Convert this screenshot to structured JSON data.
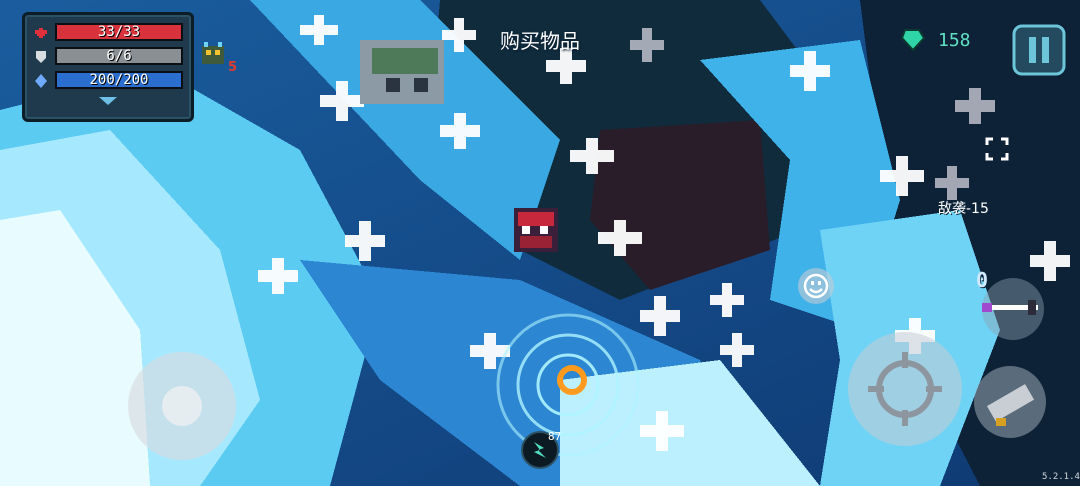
{
  "hud": {
    "hp": {
      "label": "33/33",
      "current": 33,
      "max": 33,
      "color": "#d8323c"
    },
    "armor": {
      "label": "6/6",
      "current": 6,
      "max": 6,
      "color": "#8a8f94"
    },
    "energy": {
      "label": "200/200",
      "current": 200,
      "max": 200,
      "color": "#2a6fd0"
    },
    "buff_count": "5",
    "gem_count": "158",
    "enemy_wave_label": "敌袭-15",
    "weapon_energy": "0",
    "skill_count": "87",
    "version": "5.2.1.4"
  },
  "dialog_title": "购买物品",
  "icons": {
    "heart": "heart-icon",
    "shield": "shield-icon",
    "energy": "energy-crystal-icon",
    "gem": "gem-icon",
    "pause": "pause-icon",
    "emote": "emote-icon",
    "fire": "fire-button-icon",
    "weapon_swap": "weapon-swap-icon",
    "skill": "skill-icon",
    "collapse": "chevron-down-icon"
  },
  "colors": {
    "ice_light": "#bff0ff",
    "ice_mid": "#52c6f0",
    "ice_deep": "#1d6fc0",
    "hud_panel": "#1f3a4c",
    "gem": "#2fd5a6"
  }
}
